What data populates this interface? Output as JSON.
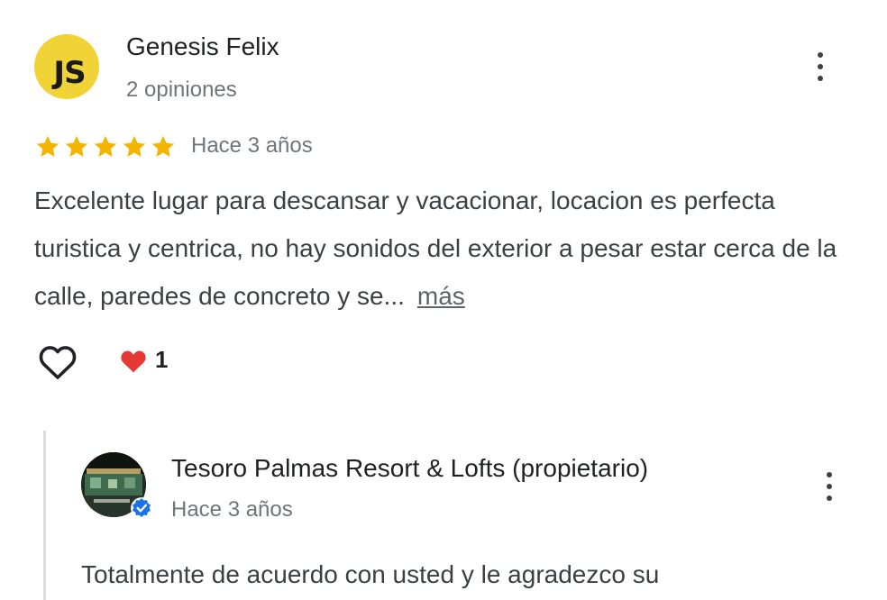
{
  "review": {
    "avatar_initials": "JS",
    "avatar_color": "#f0d336",
    "reviewer_name": "Genesis Felix",
    "reviewer_meta": "2 opiniones",
    "rating": 5,
    "rating_max": 5,
    "star_color": "#f4b400",
    "time": "Hace 3 años",
    "text": "Excelente lugar para descansar y vacacionar, locacion es perfecta turistica y centrica, no hay sonidos del exterior a pesar estar cerca de la calle, paredes de concreto y se...",
    "more_label": "más",
    "reaction_count": "1",
    "icons": [
      "more-vert-icon",
      "star-icon",
      "heart-outline-icon",
      "heart-filled-icon"
    ]
  },
  "owner_reply": {
    "name": "Tesoro Palmas Resort & Lofts (propietario)",
    "time": "Hace 3 años",
    "text": "Totalmente de acuerdo con usted y le agradezco su",
    "icons": [
      "verified-badge-icon",
      "more-vert-icon"
    ]
  }
}
